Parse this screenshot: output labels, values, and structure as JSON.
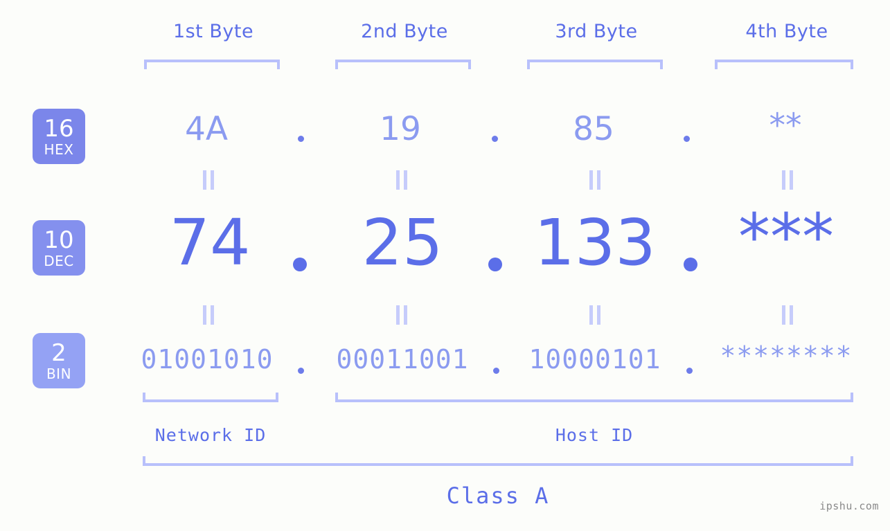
{
  "page": {
    "background_color": "#fcfdfa",
    "accent_color": "#5b6ee8",
    "accent_light_color": "#8b9bf0",
    "bracket_color": "#b8c0fb",
    "watermark": "ipshu.com"
  },
  "byte_headers": [
    {
      "label": "1st Byte"
    },
    {
      "label": "2nd Byte"
    },
    {
      "label": "3rd Byte"
    },
    {
      "label": "4th Byte"
    }
  ],
  "radix_rows": [
    {
      "badge_number": "16",
      "badge_name": "HEX",
      "badge_color": "#7b86ea",
      "values": [
        "4A",
        "19",
        "85",
        "**"
      ],
      "separator": "."
    },
    {
      "badge_number": "10",
      "badge_name": "DEC",
      "badge_color": "#8490ee",
      "values": [
        "74",
        "25",
        "133",
        "***"
      ],
      "separator": "."
    },
    {
      "badge_number": "2",
      "badge_name": "BIN",
      "badge_color": "#94a2f4",
      "values": [
        "01001010",
        "00011001",
        "10000101",
        "********"
      ],
      "separator": "."
    }
  ],
  "equivalence_marks": {
    "glyph": "||",
    "count_per_row": 4,
    "rows": 2
  },
  "id_sections": [
    {
      "label": "Network ID"
    },
    {
      "label": "Host ID"
    }
  ],
  "class_section": {
    "label": "Class A"
  }
}
